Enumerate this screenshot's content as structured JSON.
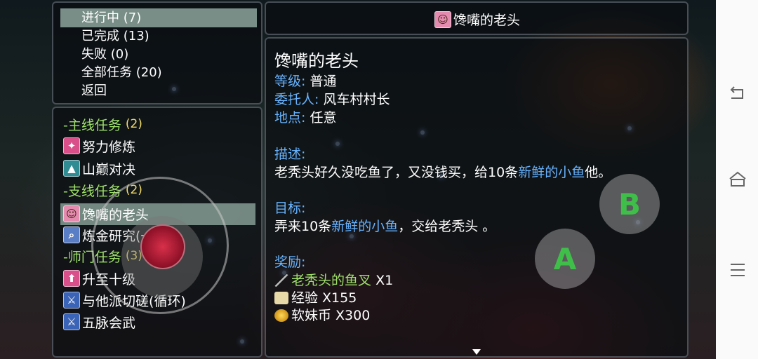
{
  "menu": {
    "items": [
      "进行中 (7)",
      "已完成 (13)",
      "失败 (0)",
      "全部任务 (20)",
      "返回"
    ],
    "selected": "进行中 (7)"
  },
  "quest_list": {
    "main_category": {
      "label": "-主线任务",
      "count": "(2)"
    },
    "main_quests": [
      "努力修炼",
      "山巅对决"
    ],
    "side_category": {
      "label": "-支线任务",
      "count": "(2)"
    },
    "side_quests": [
      "馋嘴的老头",
      "炼金研究(一)"
    ],
    "sect_category": {
      "label": "-师门任务",
      "count": "(3)"
    },
    "sect_quests": [
      "升至十级",
      "与他派切磋(循环)",
      "五脉会武"
    ],
    "selected": "馋嘴的老头"
  },
  "detail": {
    "header_title": "馋嘴的老头",
    "name": "馋嘴的老头",
    "grade_label": "等级:",
    "grade_value": "普通",
    "client_label": "委托人:",
    "client_value": "风车村村长",
    "place_label": "地点:",
    "place_value": "任意",
    "desc_label": "描述:",
    "desc_prefix": "老秃头好久没吃鱼了，又没钱买，给10条",
    "desc_highlight": "新鲜的小鱼",
    "desc_suffix": "他。",
    "goal_label": "目标:",
    "goal_prefix": "弄来10条",
    "goal_highlight": "新鲜的小鱼",
    "goal_suffix": "，交给老秃头 。",
    "reward_label": "奖励:",
    "reward_item_name": "老秃头的鱼叉",
    "reward_item_qty": "X1",
    "reward_exp": "经验 X155",
    "reward_coin": "软妹币 X300"
  },
  "controls": {
    "b_label": "B",
    "a_label": "A"
  },
  "colors": {
    "accent_blue": "#67b3ff",
    "accent_green": "#9fe06a",
    "count_yellow": "#f3dc68",
    "selection": "#8ca59b"
  },
  "icons": [
    "quest-training-icon",
    "quest-mountain-icon",
    "quest-face-icon",
    "quest-magnifier-icon",
    "quest-level-icon",
    "quest-sword-icon",
    "fork-icon",
    "scroll-icon",
    "coin-icon",
    "back-icon",
    "home-icon",
    "menu-icon"
  ]
}
